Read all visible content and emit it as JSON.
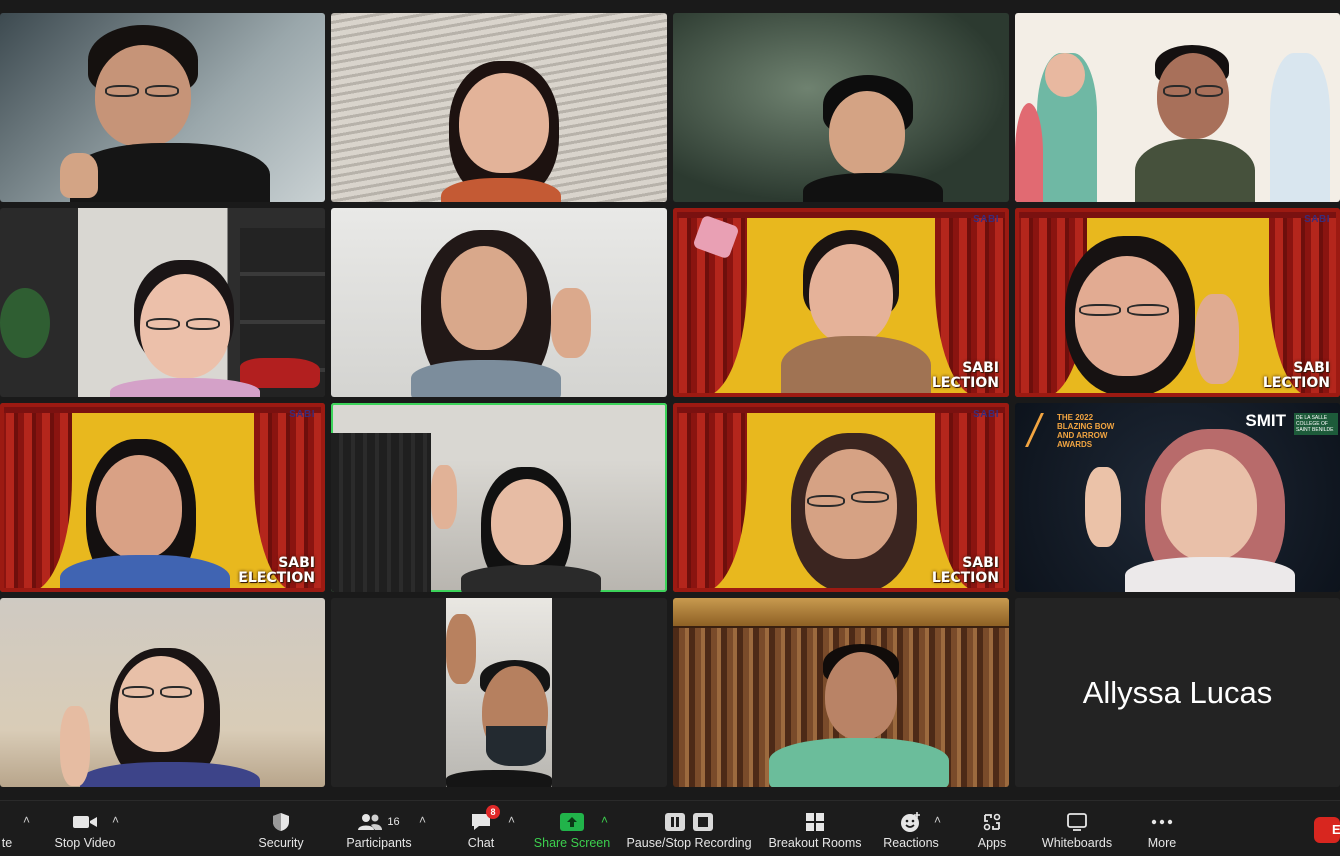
{
  "participants_tiles": [
    {
      "id": "p1",
      "name": ""
    },
    {
      "id": "p2",
      "name": ""
    },
    {
      "id": "p3",
      "name": ""
    },
    {
      "id": "p4",
      "name": ""
    },
    {
      "id": "p5",
      "name": ""
    },
    {
      "id": "p6",
      "name": ""
    },
    {
      "id": "p7",
      "name": ""
    },
    {
      "id": "p8",
      "name": ""
    },
    {
      "id": "p9",
      "name": ""
    },
    {
      "id": "p10",
      "name": ""
    },
    {
      "id": "p11",
      "name": ""
    },
    {
      "id": "p12",
      "name": ""
    },
    {
      "id": "p13",
      "name": ""
    },
    {
      "id": "p14",
      "name": ""
    },
    {
      "id": "p15",
      "name": ""
    },
    {
      "id": "p16",
      "name": "Allyssa Lucas"
    }
  ],
  "backgrounds": {
    "sabi_logo": "SABI",
    "sabi_line1": "SABI",
    "sabi_line2": "ELECTION",
    "sabi_line2_cut": "LECTION",
    "award_text": "THE 2022 BLAZING BOW AND ARROW AWARDS",
    "award_logo": "SMIT",
    "award_sub": "DE LA SALLE COLLEGE OF SAINT BENILDE"
  },
  "toolbar": {
    "mute_label_fragment": "te",
    "stop_video": "Stop Video",
    "security": "Security",
    "participants": "Participants",
    "participants_count": "16",
    "chat": "Chat",
    "chat_badge": "8",
    "share_screen": "Share Screen",
    "record": "Pause/Stop Recording",
    "breakout": "Breakout Rooms",
    "reactions": "Reactions",
    "apps": "Apps",
    "whiteboards": "Whiteboards",
    "more": "More",
    "end_fragment": "E"
  },
  "colors": {
    "accent_green": "#3cd35a",
    "share_green": "#21b44a",
    "end_red": "#d8261f",
    "badge_red": "#e02828",
    "stage_yellow": "#e8b81e",
    "curtain_red": "#b4261c"
  }
}
